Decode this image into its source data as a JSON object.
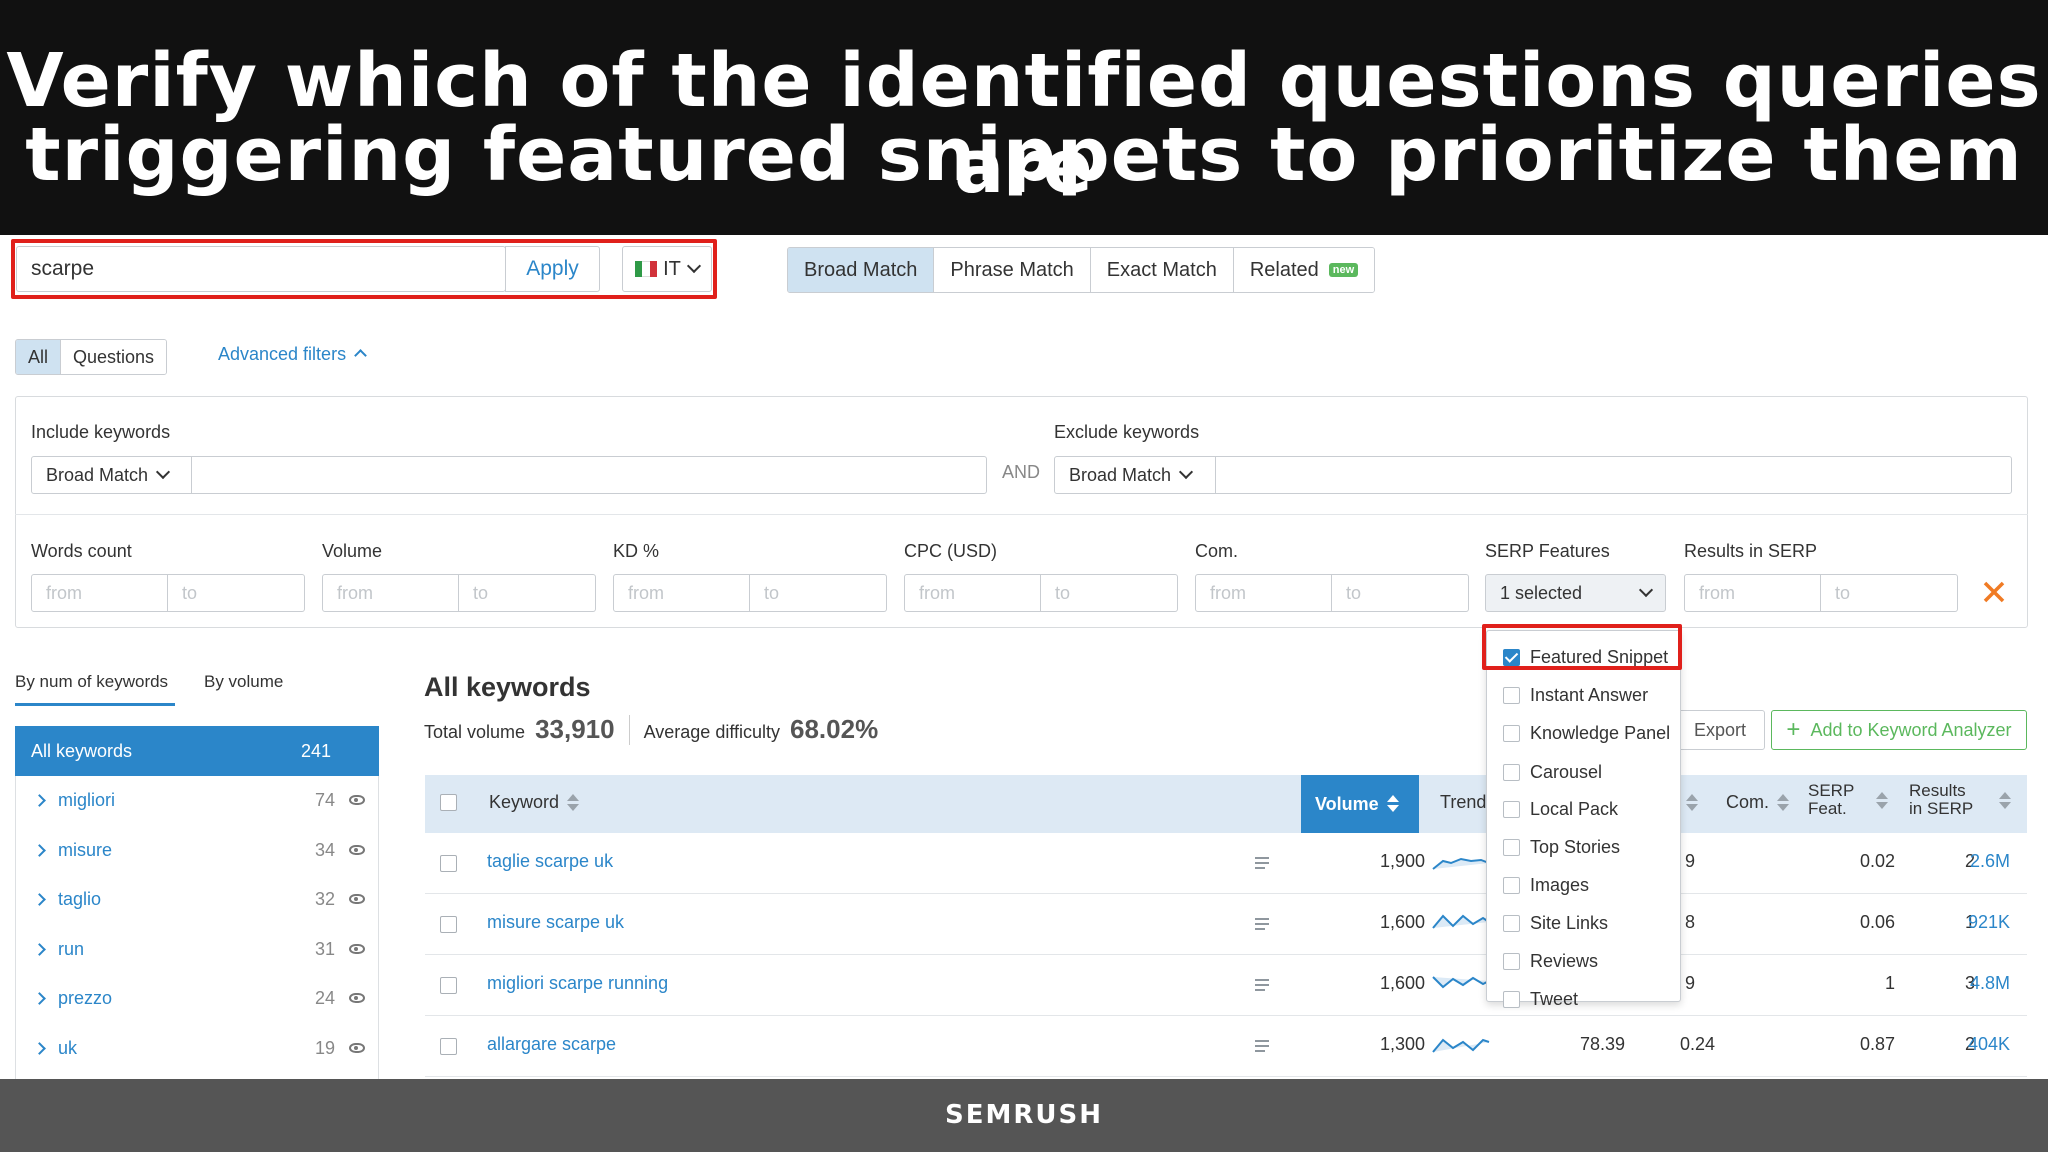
{
  "banner": {
    "line1": "Verify which of the identified questions queries are",
    "line2": "triggering featured snippets to prioritize them"
  },
  "footer": {
    "brand": "SEMRUSH"
  },
  "search": {
    "value": "scarpe",
    "apply_label": "Apply",
    "country": "IT"
  },
  "match_tabs": [
    {
      "label": "Broad Match",
      "active": true
    },
    {
      "label": "Phrase Match",
      "active": false
    },
    {
      "label": "Exact Match",
      "active": false
    },
    {
      "label": "Related",
      "active": false,
      "badge": "new"
    }
  ],
  "view_tabs": {
    "all": "All",
    "questions": "Questions",
    "advanced": "Advanced filters"
  },
  "filters": {
    "include_label": "Include keywords",
    "include_match": "Broad Match",
    "and_label": "AND",
    "exclude_label": "Exclude keywords",
    "exclude_match": "Broad Match",
    "from": "from",
    "to": "to",
    "words_count": "Words count",
    "volume": "Volume",
    "kd": "KD %",
    "cpc": "CPC (USD)",
    "com": "Com.",
    "serp_features": "SERP Features",
    "serp_selected": "1 selected",
    "results_in_serp": "Results in SERP",
    "clear_icon": "close-icon"
  },
  "serp_options": [
    {
      "label": "Featured Snippet",
      "checked": true
    },
    {
      "label": "Instant Answer",
      "checked": false
    },
    {
      "label": "Knowledge Panel",
      "checked": false
    },
    {
      "label": "Carousel",
      "checked": false
    },
    {
      "label": "Local Pack",
      "checked": false
    },
    {
      "label": "Top Stories",
      "checked": false
    },
    {
      "label": "Images",
      "checked": false
    },
    {
      "label": "Site Links",
      "checked": false
    },
    {
      "label": "Reviews",
      "checked": false
    },
    {
      "label": "Tweet",
      "checked": false
    }
  ],
  "sidebar": {
    "tab_num": "By num of keywords",
    "tab_volume": "By volume",
    "all_label": "All keywords",
    "all_count": "241",
    "groups": [
      {
        "label": "migliori",
        "count": "74"
      },
      {
        "label": "misure",
        "count": "34"
      },
      {
        "label": "taglio",
        "count": "32"
      },
      {
        "label": "run",
        "count": "31"
      },
      {
        "label": "prezzo",
        "count": "24"
      },
      {
        "label": "uk",
        "count": "19"
      }
    ]
  },
  "main": {
    "title": "All keywords",
    "total_volume_label": "Total volume",
    "total_volume": "33,910",
    "avg_difficulty_label": "Average difficulty",
    "avg_difficulty": "68.02%",
    "export_label": "Export",
    "add_label": "Add to Keyword Analyzer"
  },
  "table": {
    "headers": {
      "keyword": "Keyword",
      "volume": "Volume",
      "trend": "Trend",
      "com": "Com.",
      "serp1": "SERP",
      "serp2": "Feat.",
      "results1": "Results",
      "results2": "in SERP"
    },
    "rows": [
      {
        "keyword": "taglie scarpe uk",
        "volume": "1,900",
        "kd": "",
        "cpc_partial": "9",
        "com": "0.02",
        "serp": "2",
        "results": "2.6M"
      },
      {
        "keyword": "misure scarpe uk",
        "volume": "1,600",
        "kd": "",
        "cpc_partial": "8",
        "com": "0.06",
        "serp": "1",
        "results": "921K"
      },
      {
        "keyword": "migliori scarpe running",
        "volume": "1,600",
        "kd": "",
        "cpc_partial": "9",
        "com": "1",
        "serp": "3",
        "results": "4.8M"
      },
      {
        "keyword": "allargare scarpe",
        "volume": "1,300",
        "kd": "78.39",
        "cpc_partial": "0.24",
        "com": "0.87",
        "serp": "2",
        "results": "404K"
      }
    ]
  },
  "colors": {
    "accent": "#2b86c9",
    "highlight": "#e0201b",
    "green": "#5bb85d",
    "clear": "#f07b24"
  }
}
